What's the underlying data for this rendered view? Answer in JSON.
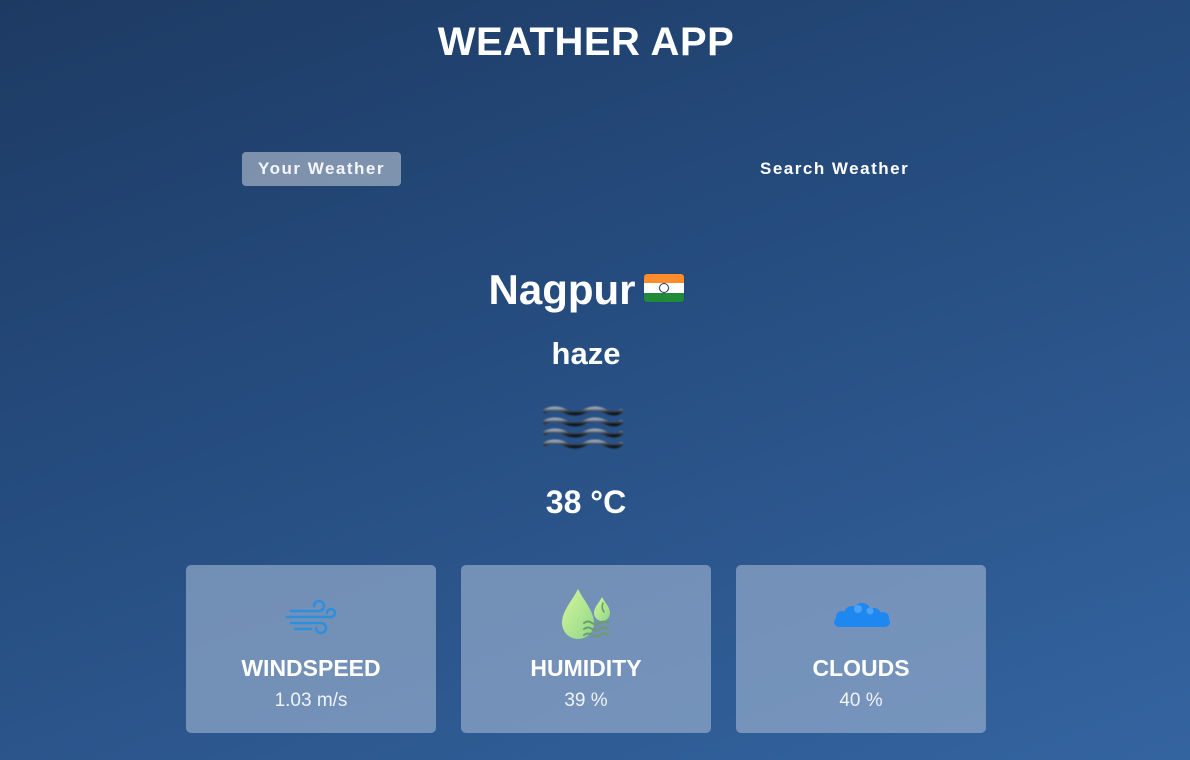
{
  "app": {
    "title": "WEATHER APP"
  },
  "tabs": [
    {
      "label": "Your Weather",
      "active": true
    },
    {
      "label": "Search Weather",
      "active": false
    }
  ],
  "weather": {
    "city": "Nagpur",
    "country_flag": "india-flag-icon",
    "condition": "haze",
    "condition_icon": "haze-icon",
    "temperature": "38 °C"
  },
  "stats": [
    {
      "label": "WINDSPEED",
      "value": "1.03 m/s",
      "icon": "wind-icon"
    },
    {
      "label": "HUMIDITY",
      "value": "39 %",
      "icon": "humidity-icon"
    },
    {
      "label": "CLOUDS",
      "value": "40 %",
      "icon": "clouds-icon"
    }
  ],
  "colors": {
    "background_top": "#1d3a63",
    "background_bottom": "#3464a0",
    "card": "#8aa0c2",
    "wind_icon": "#2f8fde",
    "humidity_icon": "#b8ee7a",
    "clouds_icon": "#1e88f0"
  }
}
